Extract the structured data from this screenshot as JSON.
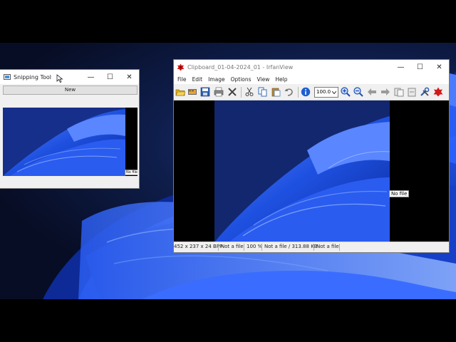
{
  "desktop": {},
  "snipping_tool": {
    "title": "Snipping Tool",
    "new_button": "New",
    "preview_label": "No file"
  },
  "irfanview": {
    "title": "Clipboard_01-04-2024_01 - IrfanView",
    "menu": [
      "File",
      "Edit",
      "Image",
      "Options",
      "View",
      "Help"
    ],
    "zoom_value": "100.0",
    "overlay_label": "No file",
    "status": [
      "452 x 237 x 24 BPP",
      "Not a file",
      "100 %",
      "Not a file / 313.88 KB",
      "Not a file"
    ]
  },
  "window_controls": {
    "minimize": "—",
    "maximize": "☐",
    "close": "✕"
  }
}
